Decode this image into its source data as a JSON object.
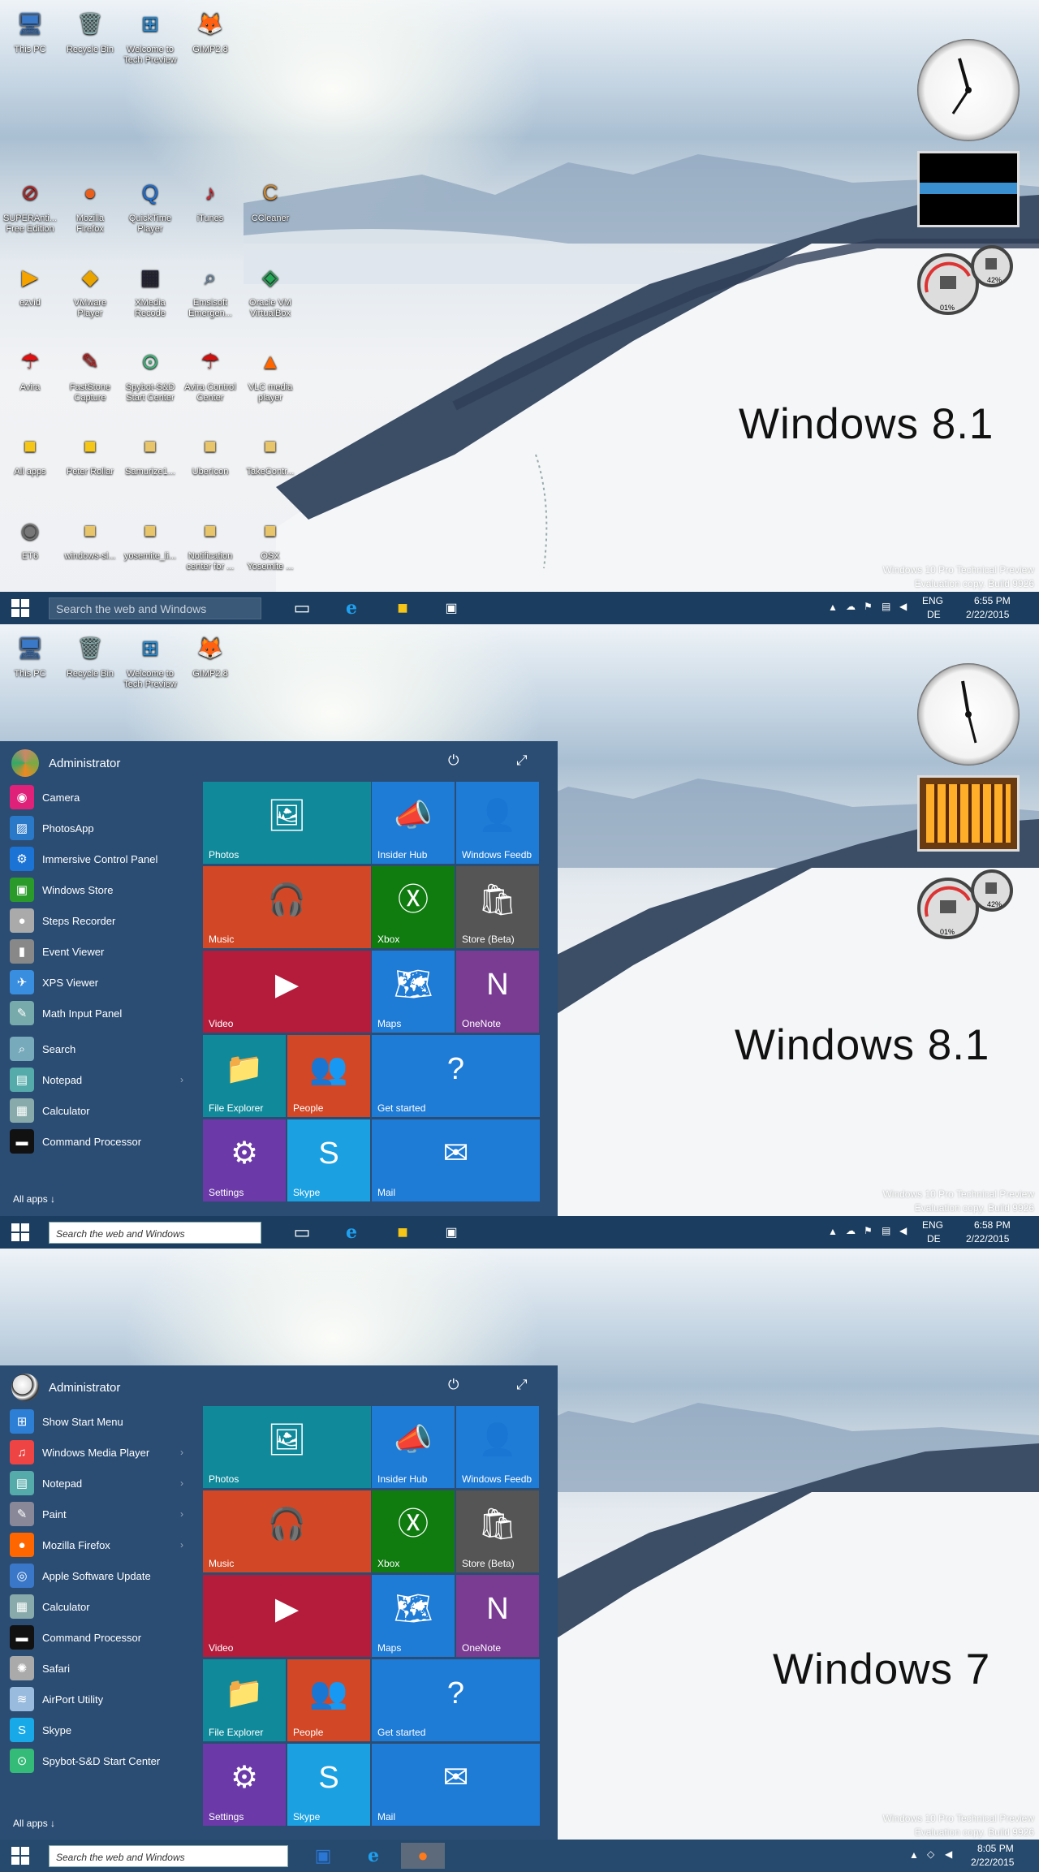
{
  "desktop_icons_top": [
    "This PC",
    "Recycle Bin",
    "Welcome to Tech Preview",
    "GIMP2.8"
  ],
  "desktop_icons_grid": [
    [
      "SUPERAnti... Free Edition",
      "Mozilla Firefox",
      "QuickTime Player",
      "iTunes",
      "CCleaner"
    ],
    [
      "ezvid",
      "VMware Player",
      "XMedia Recode",
      "Emsisoft Emergen...",
      "Oracle VM VirtualBox"
    ],
    [
      "Avira",
      "FastStone Capture",
      "Spybot-S&D Start Center",
      "Avira Control Center",
      "VLC media player"
    ],
    [
      "All apps",
      "Peter Rollar",
      "Samurize1...",
      "UberIcon",
      "TakeContr..."
    ],
    [
      "ET6",
      "windows-sl...",
      "yosemite_li...",
      "Notification center for ...",
      "OSX Yosemite ..."
    ]
  ],
  "panels": [
    {
      "label": "Windows 8.1",
      "watermark": [
        "Windows 10 Pro Technical Preview",
        "Evaluation copy. Build 9926"
      ],
      "time": "6:55 PM",
      "date": "2/22/2015"
    },
    {
      "label": "Windows 8.1",
      "watermark": [
        "Windows 10 Pro Technical Preview",
        "Evaluation copy. Build 9926"
      ],
      "time": "6:58 PM",
      "date": "2/22/2015"
    },
    {
      "label": "Windows 7",
      "watermark": [
        "Windows 10 Pro Technical Preview",
        "Evaluation copy. Build 9926"
      ],
      "time": "8:05 PM",
      "date": "2/22/2015"
    }
  ],
  "taskbar": {
    "search_placeholder": "Search the web and Windows",
    "lang": "ENG",
    "layout": "DE"
  },
  "gadgets": {
    "cpu_percent": "01%",
    "ram_percent": "42%"
  },
  "start_user": "Administrator",
  "start_all_apps": "All apps ↓",
  "menu_81": [
    "Camera",
    "PhotosApp",
    "Immersive Control Panel",
    "Windows Store",
    "Steps Recorder",
    "Event Viewer",
    "XPS Viewer",
    "Math Input Panel",
    "Search",
    "Notepad",
    "Calculator",
    "Command Processor"
  ],
  "menu_7": [
    "Show Start Menu",
    "Windows Media Player",
    "Notepad",
    "Paint",
    "Mozilla Firefox",
    "Apple Software Update",
    "Calculator",
    "Command Processor",
    "Safari",
    "AirPort Utility",
    "Skype",
    "Spybot-S&D Start Center"
  ],
  "tiles": [
    "Photos",
    "Insider Hub",
    "Windows Feedb",
    "Music",
    "Xbox",
    "Store (Beta)",
    "Video",
    "Maps",
    "OneNote",
    "File Explorer",
    "People",
    "Get started",
    "Settings",
    "Skype",
    "Mail"
  ],
  "colors": {
    "taskbar": "#1b3d5f",
    "start": "#2b4d73",
    "tile_teal": "#108a9b",
    "tile_blue": "#1e7bd6",
    "tile_orange": "#d24726",
    "tile_green": "#107c10",
    "tile_grey": "#555555",
    "tile_red": "#b51c3c",
    "tile_purple": "#7a3b92",
    "tile_violet": "#6b3aa8",
    "tile_cyan": "#1ba1e2"
  }
}
